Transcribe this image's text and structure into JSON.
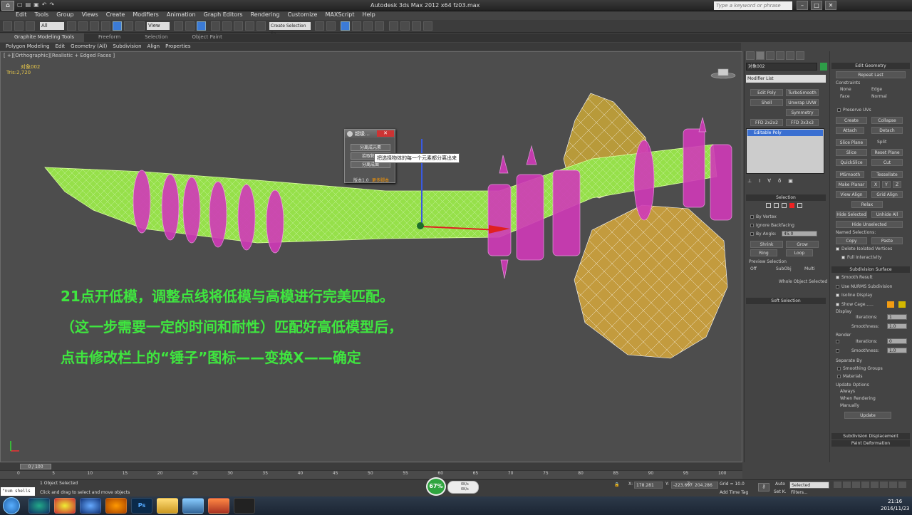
{
  "window": {
    "title": "Autodesk 3ds Max  2012 x64    fz03.max",
    "search_placeholder": "Type a keyword or phrase"
  },
  "menu": [
    "Edit",
    "Tools",
    "Group",
    "Views",
    "Create",
    "Modifiers",
    "Animation",
    "Graph Editors",
    "Rendering",
    "Customize",
    "MAXScript",
    "Help"
  ],
  "toolbar": {
    "selection_filter": "All",
    "reference_coord": "View",
    "named_selection": "Create Selection Se"
  },
  "ribbon": {
    "tabs": [
      "Graphite Modeling Tools",
      "Freeform",
      "Selection",
      "Object Paint"
    ],
    "panels": [
      "Polygon Modeling",
      "Edit",
      "Geometry (All)",
      "Subdivision",
      "Align",
      "Properties"
    ]
  },
  "viewport": {
    "label": "[ +][Orthographic][Realistic + Edged Faces ]",
    "object_name": "对象002",
    "tris": "Tris:2,720",
    "overlay_lines": [
      "21点开低模，调整点线将低模与高模进行完美匹配。",
      "（这一步需要一定的时间和耐性）匹配好高低模型后，",
      "点击修改栏上的“锤子”图标——变换X——确定"
    ]
  },
  "script_window": {
    "title": "超级…",
    "close": "✕",
    "buttons": [
      "分离成元素",
      "拾取物体",
      "分离成面"
    ],
    "version": "版本1.0",
    "more": "更多脚本",
    "tooltip": "把选择物体的每一个元素都分离出来"
  },
  "command_panel": {
    "object_name": "对象002",
    "modifier_list": "Modifier List",
    "modifier_buttons": [
      "Edit Poly",
      "TurboSmooth",
      "Shell",
      "Unwrap UVW",
      "Symmetry",
      "FFD 2x2x2",
      "FFD 3x3x3"
    ],
    "stack_item": "Editable Poly",
    "selection": {
      "title": "Selection",
      "by_vertex": "By Vertex",
      "ignore_backfacing": "Ignore Backfacing",
      "by_angle": "By Angle:",
      "angle_value": "45.0",
      "shrink": "Shrink",
      "grow": "Grow",
      "ring": "Ring",
      "loop": "Loop",
      "preview_selection": "Preview Selection",
      "preview_options": [
        "Off",
        "SubObj",
        "Multi"
      ],
      "status": "Whole Object Selected"
    },
    "soft_selection": "Soft Selection"
  },
  "right_panel": {
    "edit_geometry": "Edit Geometry",
    "repeat_last": "Repeat Last",
    "constraints": "Constraints",
    "constraint_options": [
      "None",
      "Edge",
      "Face",
      "Normal"
    ],
    "preserve_uvs": "Preserve UVs",
    "buttons": [
      [
        "Create",
        "Collapse"
      ],
      [
        "Attach",
        "Detach"
      ],
      [
        "Slice Plane",
        "Split"
      ],
      [
        "Slice",
        "Reset Plane"
      ],
      [
        "QuickSlice",
        "Cut"
      ],
      [
        "MSmooth",
        "Tessellate"
      ],
      [
        "Make Planar",
        "X",
        "Y",
        "Z"
      ],
      [
        "View Align",
        "Grid Align"
      ],
      [
        "Relax"
      ],
      [
        "Hide Selected",
        "Unhide All"
      ],
      [
        "Hide Unselected"
      ]
    ],
    "named_selections": "Named Selections:",
    "copy": "Copy",
    "paste": "Paste",
    "delete_isolated": "Delete Isolated Vertices",
    "full_interactivity": "Full Interactivity",
    "subdivision_surface": "Subdivision Surface",
    "smooth_result": "Smooth Result",
    "use_nurms": "Use NURMS Subdivision",
    "isoline_display": "Isoline Display",
    "show_cage": "Show Cage......",
    "display": "Display",
    "iterations": "Iterations:",
    "smoothness": "Smoothness:",
    "display_iterations": "1",
    "display_smoothness": "1.0",
    "render": "Render",
    "render_iterations": "0",
    "render_smoothness": "1.0",
    "separate_by": "Separate By",
    "smoothing_groups": "Smoothing Groups",
    "materials": "Materials",
    "update_options": "Update Options",
    "update_choices": [
      "Always",
      "When Rendering",
      "Manually"
    ],
    "update": "Update",
    "subdivision_displacement": "Subdivision Displacement",
    "paint_deformation": "Paint Deformation",
    "cage_colors": [
      "#f39c12",
      "#d4b800"
    ]
  },
  "timeline": {
    "frame": "0 / 100",
    "ticks": [
      "0",
      "5",
      "10",
      "15",
      "20",
      "25",
      "30",
      "35",
      "40",
      "45",
      "50",
      "55",
      "60",
      "65",
      "70",
      "75",
      "80",
      "85",
      "90",
      "95",
      "100"
    ]
  },
  "status": {
    "maxscript": "\"num shells",
    "selected": "1 Object Selected",
    "prompt": "Click and drag to select and move objects",
    "network_percent": "67%",
    "net_up": "0K/s",
    "net_down": "0K/s",
    "x": "178.281",
    "y": "-223.697",
    "z": "204.286",
    "grid": "Grid = 10.0",
    "add_time_tag": "Add Time Tag",
    "auto": "Auto",
    "set_key": "Set K.",
    "key_mode": "Selected",
    "filters": "Filters..."
  },
  "taskbar": {
    "apps": [
      "Chrome",
      "Blue",
      "Orange",
      "Ps",
      "Folder",
      "Pics",
      "Camera",
      "3ds"
    ],
    "time": "21:16",
    "date": "2016/11/23"
  }
}
